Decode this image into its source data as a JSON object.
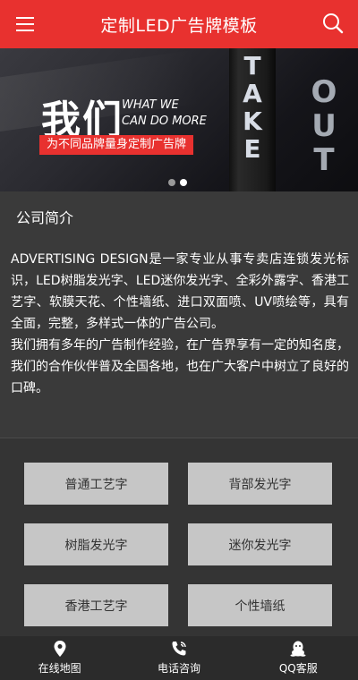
{
  "header": {
    "title": "定制LED广告牌模板",
    "menu_icon": "menu-icon",
    "search_icon": "search-icon"
  },
  "banner": {
    "headline": "我们",
    "en_line1": "WHAT WE",
    "en_line2": "CAN DO MORE",
    "tagline": "为不同品牌量身定制广告牌",
    "sign_text": "TAKE OUT",
    "slides": 2,
    "active_slide": 2
  },
  "about": {
    "heading": "公司简介",
    "paragraphs": [
      "ADVERTISING DESIGN是一家专业从事专卖店连锁发光标识，LED树脂发光字、LED迷你发光字、全彩外露字、香港工艺字、软膜天花、个性墙纸、进口双面喷、UV喷绘等，具有全面，完整，多样式一体的广告公司。",
      "我们拥有多年的广告制作经验，在广告界享有一定的知名度，我们的合作伙伴普及全国各地，也在广大客户中树立了良好的口碑。"
    ]
  },
  "categories": [
    "普通工艺字",
    "背部发光字",
    "树脂发光字",
    "迷你发光字",
    "香港工艺字",
    "个性墙纸"
  ],
  "footer": {
    "tabs": [
      {
        "label": "在线地图",
        "icon": "map-pin-icon"
      },
      {
        "label": "电话咨询",
        "icon": "phone-icon"
      },
      {
        "label": "QQ客服",
        "icon": "qq-icon"
      }
    ]
  },
  "colors": {
    "accent": "#e8312f",
    "background": "#3a3a3a",
    "button": "#c6c6c6"
  }
}
